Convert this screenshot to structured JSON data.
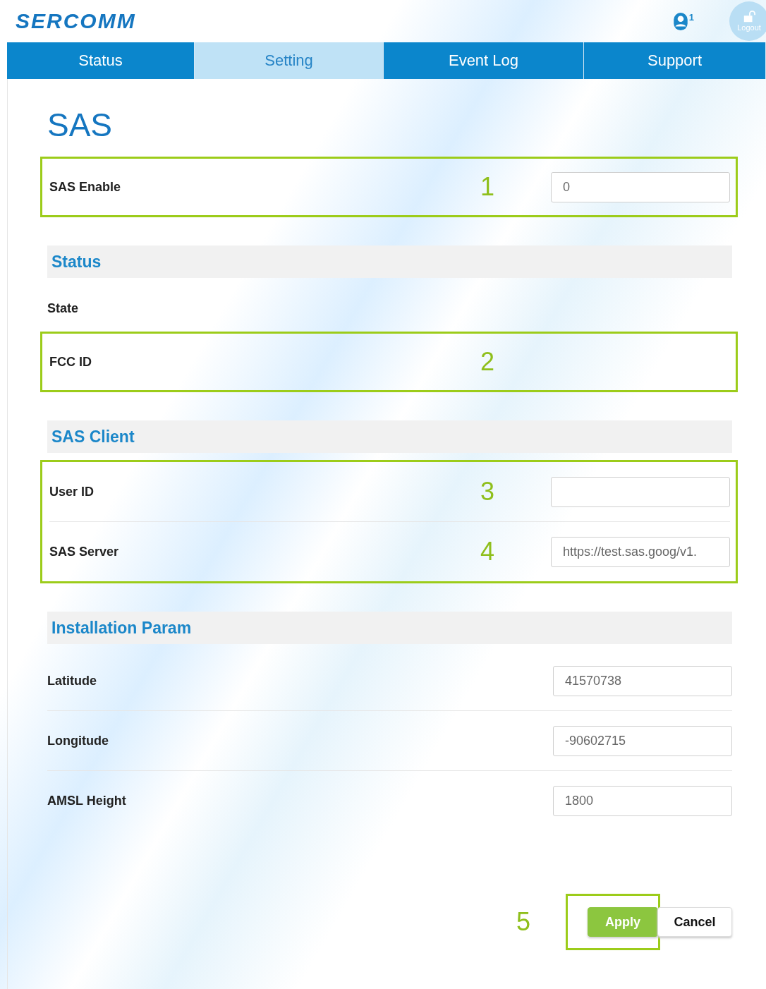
{
  "header": {
    "logo": "SERCOMM",
    "user_count": "1",
    "logout": "Logout"
  },
  "tabs": [
    {
      "label": "Status",
      "selected": false
    },
    {
      "label": "Setting",
      "selected": true
    },
    {
      "label": "Event Log",
      "selected": false
    },
    {
      "label": "Support",
      "selected": false
    }
  ],
  "title": "SAS",
  "blocks": [
    {
      "kind": "group",
      "outlined": true,
      "rows": [
        {
          "label": "SAS Enable",
          "marker": "1",
          "kind": "input",
          "value": "0"
        }
      ]
    },
    {
      "kind": "section",
      "title": "Status"
    },
    {
      "kind": "group",
      "outlined": false,
      "rows": [
        {
          "label": "State",
          "kind": "plain"
        }
      ]
    },
    {
      "kind": "group",
      "outlined": true,
      "rows": [
        {
          "label": "FCC ID",
          "marker": "2",
          "kind": "plain"
        }
      ]
    },
    {
      "kind": "section",
      "title": "SAS Client"
    },
    {
      "kind": "group",
      "outlined": true,
      "rows": [
        {
          "label": "User ID",
          "marker": "3",
          "kind": "input"
        },
        {
          "label": "SAS Server",
          "marker": "4",
          "kind": "input",
          "value": "https://test.sas.goog/v1."
        }
      ]
    },
    {
      "kind": "section",
      "title": "Installation Param"
    },
    {
      "kind": "group",
      "outlined": false,
      "rows": [
        {
          "label": "Latitude",
          "kind": "input",
          "value": "41570738"
        },
        {
          "label": "Longitude",
          "kind": "input",
          "value": "-90602715"
        },
        {
          "label": "AMSL Height",
          "kind": "input",
          "value": "1800"
        }
      ]
    }
  ],
  "actions": {
    "marker": "5",
    "buttons": [
      {
        "label": "Apply",
        "kind": "primary",
        "outlined": true
      },
      {
        "label": "Cancel",
        "kind": "secondary",
        "outlined": false
      }
    ]
  }
}
